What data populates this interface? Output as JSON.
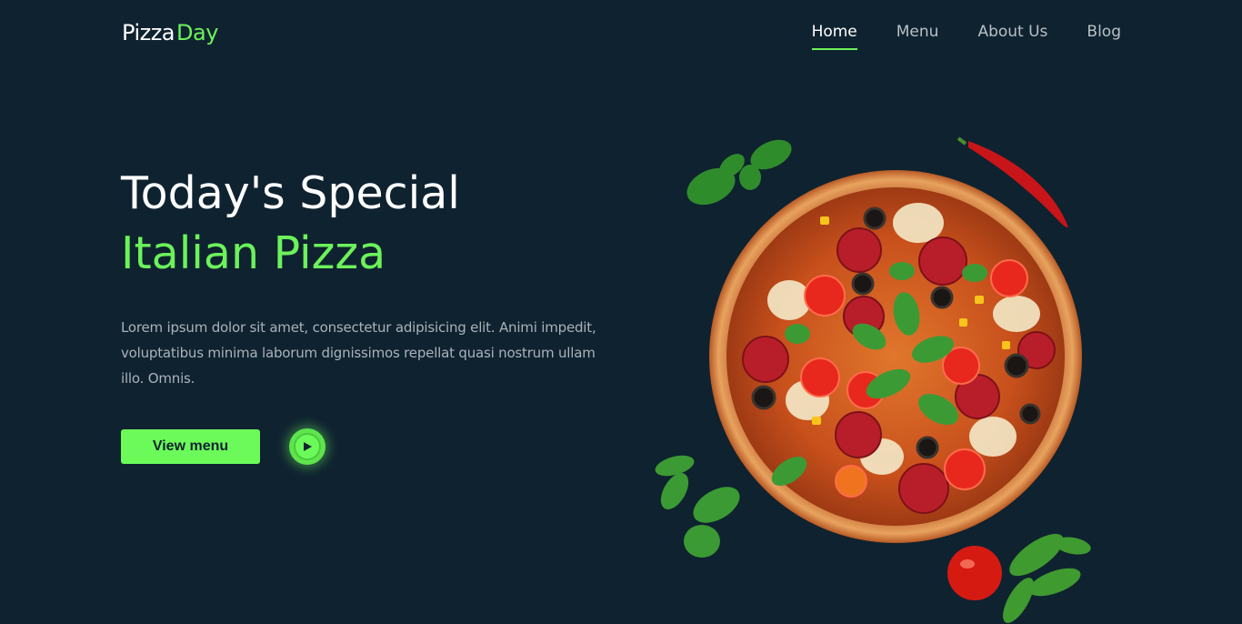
{
  "brand": {
    "part1": "Pizza",
    "part2": "Day"
  },
  "nav": {
    "items": [
      {
        "label": "Home",
        "active": true
      },
      {
        "label": "Menu",
        "active": false
      },
      {
        "label": "About Us",
        "active": false
      },
      {
        "label": "Blog",
        "active": false
      }
    ]
  },
  "hero": {
    "title_line1": "Today's Special",
    "title_line2": "Italian Pizza",
    "description": "Lorem ipsum dolor sit amet, consectetur adipisicing elit. Animi impedit, voluptatibus minima laborum dignissimos repellat quasi nostrum ullam illo. Omnis.",
    "cta_label": "View menu"
  },
  "colors": {
    "background": "#0f2230",
    "accent": "#6cf25a",
    "text_muted": "#a9b3ba"
  },
  "icons": {
    "play": "play-icon",
    "image": "pizza-image"
  }
}
